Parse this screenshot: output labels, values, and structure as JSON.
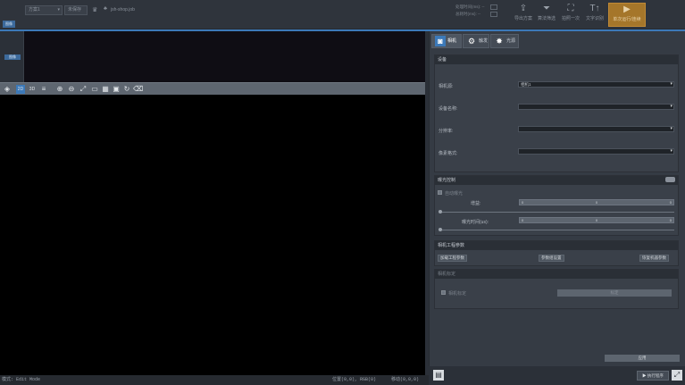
{
  "topbar": {
    "combo1": "方案1",
    "combo2": "",
    "file_label": "未保存",
    "status_label": "jsh-shop.job",
    "info_line1": "处理时间(ms): --",
    "info_line2": "总耗时(ms): --",
    "buttons": [
      {
        "label": "导出方案",
        "icon": "export-icon"
      },
      {
        "label": "算法筛选",
        "icon": "filter-icon"
      },
      {
        "label": "拍照一次",
        "icon": "capture-icon"
      },
      {
        "label": "文字识别",
        "icon": "text-icon"
      },
      {
        "label": "单次运行/连续",
        "icon": "run-icon"
      }
    ],
    "mini_tab": "图像"
  },
  "left": {
    "thumb_label": "图像"
  },
  "status": {
    "mode": "模式: Edit Mode",
    "position": "位置(0,0), RGB(0)",
    "offset": "移动(0,0,0)"
  },
  "right": {
    "tabs": [
      {
        "label": "相机",
        "icon": "camera-icon"
      },
      {
        "label": "触发",
        "icon": "trigger-icon"
      },
      {
        "label": "光源",
        "icon": "light-icon"
      }
    ],
    "device": {
      "title": "设备",
      "fields": [
        {
          "label": "相机源:",
          "value": "相机1"
        },
        {
          "label": "设备名称:",
          "value": ""
        },
        {
          "label": "分辨率:",
          "value": ""
        },
        {
          "label": "像素格式:",
          "value": ""
        }
      ]
    },
    "exposure": {
      "title": "曝光控制",
      "auto_label": "自动曝光",
      "gain_label": "增益:",
      "gain_min": "0",
      "gain_value": "0",
      "gain_max": "0",
      "exposure_label": "曝光时间(us):",
      "exp_min": "0",
      "exp_value": "0",
      "exp_max": "0"
    },
    "params": {
      "title": "相机工程参数",
      "btn1": "加载工程参数",
      "btn2": "参数组设置",
      "btn3": "恢复机器参数"
    },
    "calib": {
      "title": "相机标定",
      "check_label": "相机标定",
      "btn": "标定"
    },
    "apply_btn": "应用",
    "bottom_btn": "执行程序"
  },
  "colors": {
    "accent": "#3c79b8",
    "run_button": "#a5762a"
  }
}
